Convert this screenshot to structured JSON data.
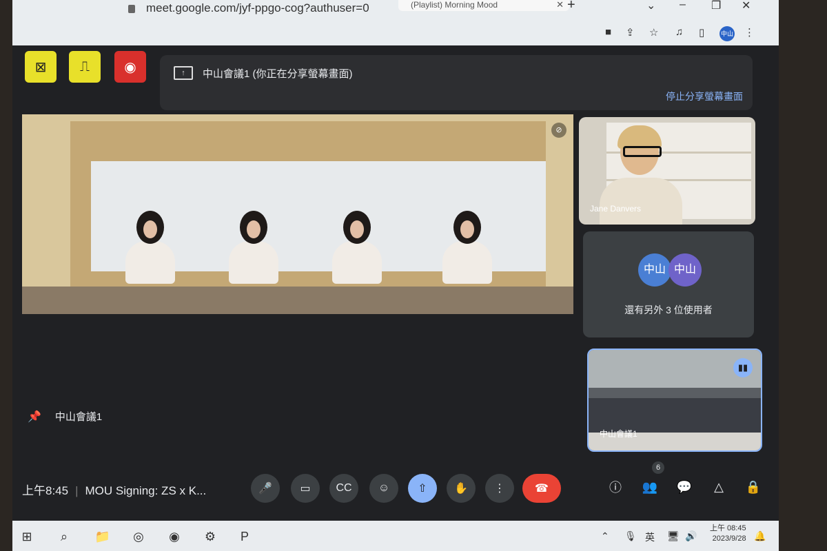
{
  "browser": {
    "url": "meet.google.com/jyf-ppgo-cog?authuser=0",
    "tab_title": "(Playlist) Morning Mood",
    "profile_label": "中山"
  },
  "meet": {
    "share_banner": {
      "title": "中山會議1 (你正在分享螢幕畫面)",
      "stop_label": "停止分享螢幕畫面"
    },
    "main_tile_name": "中山會議1",
    "tiles": {
      "jane_name": "Jane Danvers",
      "others": {
        "avatars": [
          "中山",
          "中山"
        ],
        "label": "還有另外 3 位使用者"
      },
      "room_name": "中山會議1"
    },
    "bottom": {
      "time": "上午8:45",
      "meeting_title": "MOU Signing: ZS x K...",
      "participants_count": "6"
    },
    "colors": {
      "accent": "#8ab4f8",
      "end_call": "#ea4335",
      "host_control_yellow": "#e8e02a",
      "record_red": "#d9302c"
    }
  },
  "taskbar": {
    "ime_label": "英",
    "clock_time": "上午 08:45",
    "clock_date": "2023/9/28"
  }
}
